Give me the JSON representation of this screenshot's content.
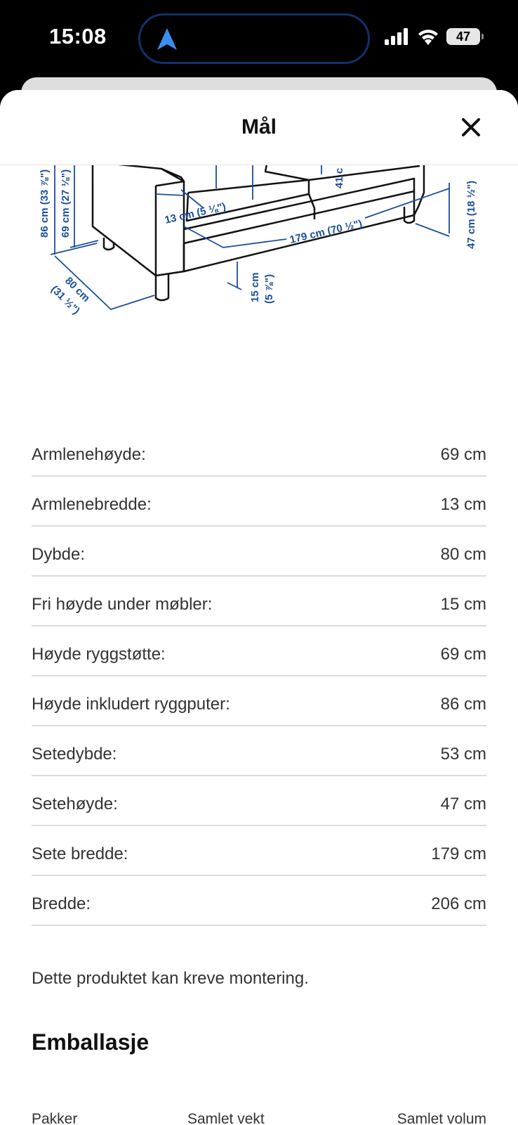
{
  "status_bar": {
    "time": "15:08",
    "battery": "47"
  },
  "sheet": {
    "title": "Mål"
  },
  "illustration": {
    "labels": {
      "height_total": "86 cm (33 ⅞\")",
      "height_back": "69 cm (27 ⅛\")",
      "arm_width": "13 cm (5 ⅛\")",
      "seat_width": "179 cm (70 ½\")",
      "seat_depth_partial": "41 c",
      "seat_height": "47 cm (18 ½\")",
      "depth_cm": "80 cm",
      "depth_in": "(31 ½\")",
      "clearance_cm": "15 cm",
      "clearance_in": "(5 ⅞\")"
    }
  },
  "dimensions": [
    {
      "label": "Armlenehøyde:",
      "value": "69 cm"
    },
    {
      "label": "Armlenebredde:",
      "value": "13 cm"
    },
    {
      "label": "Dybde:",
      "value": "80 cm"
    },
    {
      "label": "Fri høyde under møbler:",
      "value": "15 cm"
    },
    {
      "label": "Høyde ryggstøtte:",
      "value": "69 cm"
    },
    {
      "label": "Høyde inkludert ryggputer:",
      "value": "86 cm"
    },
    {
      "label": "Setedybde:",
      "value": "53 cm"
    },
    {
      "label": "Setehøyde:",
      "value": "47 cm"
    },
    {
      "label": "Sete bredde:",
      "value": "179 cm"
    },
    {
      "label": "Bredde:",
      "value": "206 cm"
    }
  ],
  "note": "Dette produktet kan kreve montering.",
  "packaging": {
    "title": "Emballasje",
    "columns": [
      "Pakker",
      "Samlet vekt",
      "Samlet volum"
    ]
  },
  "colors": {
    "dimension_blue": "#1b4f9c",
    "divider": "#dcdcdc"
  }
}
